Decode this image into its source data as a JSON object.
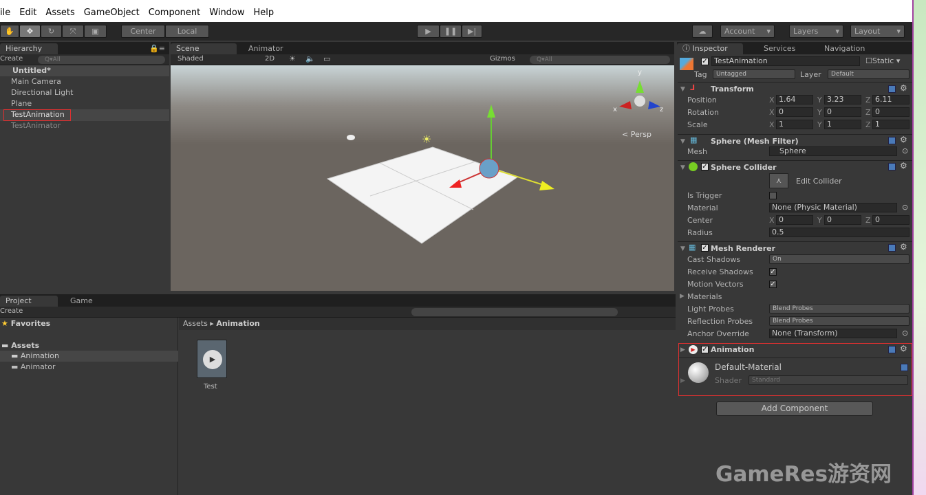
{
  "menu": [
    "ile",
    "Edit",
    "Assets",
    "GameObject",
    "Component",
    "Window",
    "Help"
  ],
  "toolbar": {
    "tools": [
      "hand-tool",
      "move-tool",
      "rotate-tool",
      "scale-tool",
      "rect-tool"
    ],
    "pivot": "Center",
    "space": "Local",
    "account": "Account",
    "layers": "Layers",
    "layout": "Layout"
  },
  "hierarchy": {
    "tab": "Hierarchy",
    "create": "Create",
    "search": "Q▾All",
    "scene": "Untitled*",
    "items": [
      "Main Camera",
      "Directional Light",
      "Plane",
      "TestAnimation",
      "TestAnimator"
    ],
    "selected": "TestAnimation"
  },
  "scene": {
    "tab": "Scene",
    "animator_tab": "Animator",
    "shading": "Shaded",
    "mode2d": "2D",
    "gizmos": "Gizmos",
    "search": "Q▾All",
    "persp": "< Persp",
    "axis_y": "y",
    "axis_x": "x",
    "axis_z": "z"
  },
  "project": {
    "tab": "Project",
    "game_tab": "Game",
    "create": "Create",
    "favorites": "Favorites",
    "assets": "Assets",
    "folders": [
      "Animation",
      "Animator"
    ],
    "breadcrumb_root": "Assets",
    "breadcrumb_current": "Animation",
    "asset": "Test"
  },
  "inspector": {
    "tab": "Inspector",
    "services": "Services",
    "navigation": "Navigation",
    "name": "TestAnimation",
    "static": "Static",
    "tag_label": "Tag",
    "tag": "Untagged",
    "layer_label": "Layer",
    "layer": "Default",
    "transform": {
      "title": "Transform",
      "rows": [
        {
          "label": "Position",
          "x": "1.64",
          "y": "3.23",
          "z": "6.11"
        },
        {
          "label": "Rotation",
          "x": "0",
          "y": "0",
          "z": "0"
        },
        {
          "label": "Scale",
          "x": "1",
          "y": "1",
          "z": "1"
        }
      ]
    },
    "mesh_filter": {
      "title": "Sphere (Mesh Filter)",
      "mesh_label": "Mesh",
      "mesh": "Sphere"
    },
    "sphere_collider": {
      "title": "Sphere Collider",
      "edit": "Edit Collider",
      "is_trigger": "Is Trigger",
      "material_label": "Material",
      "material": "None (Physic Material)",
      "center_label": "Center",
      "cx": "0",
      "cy": "0",
      "cz": "0",
      "radius_label": "Radius",
      "radius": "0.5"
    },
    "mesh_renderer": {
      "title": "Mesh Renderer",
      "cast_shadows": "Cast Shadows",
      "cast_value": "On",
      "receive_shadows": "Receive Shadows",
      "motion_vectors": "Motion Vectors",
      "materials": "Materials",
      "light_probes": "Light Probes",
      "light_value": "Blend Probes",
      "reflection_probes": "Reflection Probes",
      "reflection_value": "Blend Probes",
      "anchor": "Anchor Override",
      "anchor_value": "None (Transform)"
    },
    "animation": {
      "title": "Animation"
    },
    "material": {
      "name": "Default-Material",
      "shader_label": "Shader",
      "shader": "Standard"
    },
    "add_component": "Add Component"
  },
  "watermark": "GameRes游资网",
  "colors": {
    "highlight": "#e03030",
    "selection": "#4a4a4a"
  }
}
